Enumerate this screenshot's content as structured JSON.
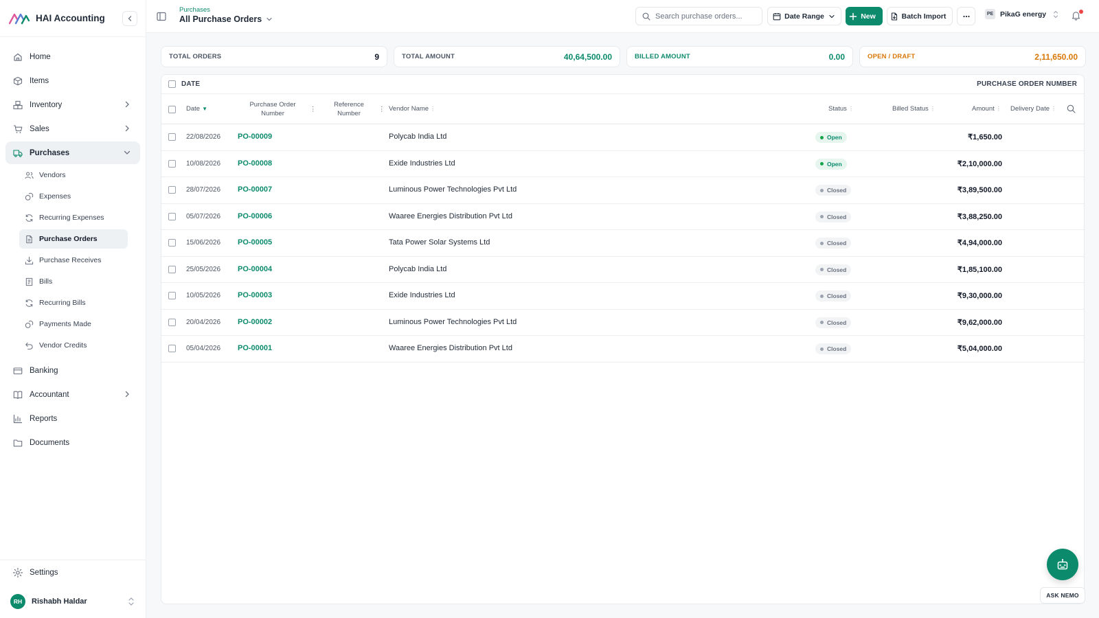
{
  "app": {
    "name": "HAI Accounting"
  },
  "colors": {
    "accent": "#0b8a6c",
    "open_badge_bg": "#e6f6ef",
    "open_badge_fg": "#0b8a6c",
    "closed_badge_bg": "#f1f3f5",
    "closed_badge_fg": "#6b7280",
    "draft_fg": "#d97706",
    "bell_dot": "#ef4444"
  },
  "sidebar": {
    "items_top": [
      {
        "label": "Home",
        "icon": "home-icon"
      },
      {
        "label": "Items",
        "icon": "box-icon"
      },
      {
        "label": "Inventory",
        "icon": "boxes-icon",
        "chevron": "right"
      },
      {
        "label": "Sales",
        "icon": "cart-icon",
        "chevron": "right"
      },
      {
        "label": "Purchases",
        "icon": "truck-icon",
        "chevron": "down",
        "active": true
      }
    ],
    "purchases_sub": [
      {
        "label": "Vendors",
        "icon": "users-icon"
      },
      {
        "label": "Expenses",
        "icon": "coins-icon"
      },
      {
        "label": "Recurring Expenses",
        "icon": "refresh-icon"
      },
      {
        "label": "Purchase Orders",
        "icon": "document-icon",
        "active": true
      },
      {
        "label": "Purchase Receives",
        "icon": "download-icon"
      },
      {
        "label": "Bills",
        "icon": "receipt-icon"
      },
      {
        "label": "Recurring Bills",
        "icon": "refresh-icon"
      },
      {
        "label": "Payments Made",
        "icon": "coins-icon"
      },
      {
        "label": "Vendor Credits",
        "icon": "undo-icon"
      }
    ],
    "items_bottom": [
      {
        "label": "Banking",
        "icon": "card-icon"
      },
      {
        "label": "Accountant",
        "icon": "book-icon",
        "chevron": "right"
      },
      {
        "label": "Reports",
        "icon": "chart-icon"
      },
      {
        "label": "Documents",
        "icon": "folder-icon"
      }
    ],
    "settings_label": "Settings",
    "user": {
      "initials": "RH",
      "name": "Rishabh Haldar"
    }
  },
  "topbar": {
    "breadcrumb_parent": "Purchases",
    "title": "All Purchase Orders",
    "search_placeholder": "Search purchase orders...",
    "date_range_label": "Date Range",
    "new_label": "New",
    "batch_import_label": "Batch Import",
    "org_badge": "PE",
    "org_name": "PikaG energy"
  },
  "stats": [
    {
      "key": "TOTAL ORDERS",
      "value": "9",
      "tone": "neutral"
    },
    {
      "key": "TOTAL AMOUNT",
      "value": "40,64,500.00",
      "tone": "accent"
    },
    {
      "key": "BILLED AMOUNT",
      "value": "0.00",
      "tone": "accent"
    },
    {
      "key": "OPEN / DRAFT",
      "value": "2,11,650.00",
      "tone": "draft"
    }
  ],
  "table": {
    "group_left": "DATE",
    "group_right": "PURCHASE ORDER NUMBER",
    "headers": {
      "date": "Date",
      "po_number": [
        "Purchase Order",
        "Number"
      ],
      "reference": [
        "Reference",
        "Number"
      ],
      "vendor": "Vendor Name",
      "status": "Status",
      "billed_status": "Billed Status",
      "amount": "Amount",
      "delivery_date": "Delivery Date"
    },
    "rows": [
      {
        "date": "22/08/2026",
        "po": "PO-00009",
        "vendor": "Polycab India Ltd",
        "status": "Open",
        "amount": "₹1,650.00"
      },
      {
        "date": "10/08/2026",
        "po": "PO-00008",
        "vendor": "Exide Industries Ltd",
        "status": "Open",
        "amount": "₹2,10,000.00"
      },
      {
        "date": "28/07/2026",
        "po": "PO-00007",
        "vendor": "Luminous Power Technologies Pvt Ltd",
        "status": "Closed",
        "amount": "₹3,89,500.00"
      },
      {
        "date": "05/07/2026",
        "po": "PO-00006",
        "vendor": "Waaree Energies Distribution Pvt Ltd",
        "status": "Closed",
        "amount": "₹3,88,250.00"
      },
      {
        "date": "15/06/2026",
        "po": "PO-00005",
        "vendor": "Tata Power Solar Systems Ltd",
        "status": "Closed",
        "amount": "₹4,94,000.00"
      },
      {
        "date": "25/05/2026",
        "po": "PO-00004",
        "vendor": "Polycab India Ltd",
        "status": "Closed",
        "amount": "₹1,85,100.00"
      },
      {
        "date": "10/05/2026",
        "po": "PO-00003",
        "vendor": "Exide Industries Ltd",
        "status": "Closed",
        "amount": "₹9,30,000.00"
      },
      {
        "date": "20/04/2026",
        "po": "PO-00002",
        "vendor": "Luminous Power Technologies Pvt Ltd",
        "status": "Closed",
        "amount": "₹9,62,000.00"
      },
      {
        "date": "05/04/2026",
        "po": "PO-00001",
        "vendor": "Waaree Energies Distribution Pvt Ltd",
        "status": "Closed",
        "amount": "₹5,04,000.00"
      }
    ]
  },
  "assistant": {
    "label": "ASK NEMO"
  }
}
